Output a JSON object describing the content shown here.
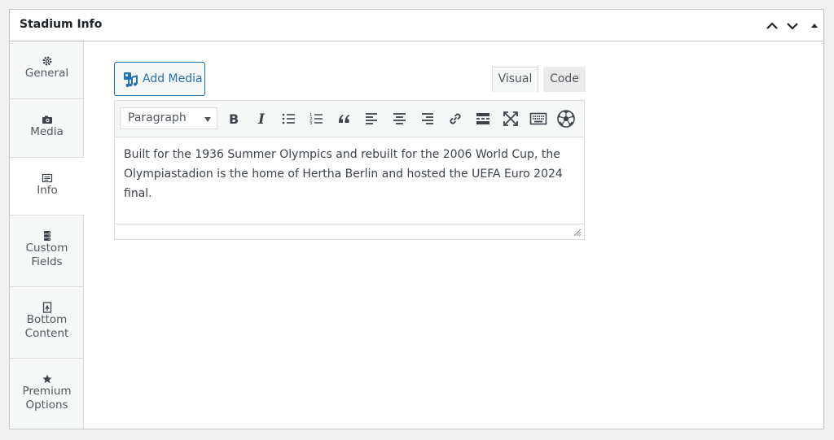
{
  "panel": {
    "title": "Stadium Info",
    "controls": [
      "chevron-up-icon",
      "chevron-down-icon",
      "triangle-up-icon"
    ]
  },
  "sidebar": {
    "items": [
      {
        "label": "General",
        "icon": "gear-icon"
      },
      {
        "label": "Media",
        "icon": "camera-icon"
      },
      {
        "label": "Info",
        "icon": "text-page-icon",
        "active": true
      },
      {
        "label": "Custom\nFields",
        "icon": "database-icon"
      },
      {
        "label": "Bottom\nContent",
        "icon": "page-icon"
      },
      {
        "label": "Premium\nOptions",
        "icon": "star-icon"
      }
    ]
  },
  "editor": {
    "add_media_label": "Add Media",
    "mode_tabs": {
      "visual": "Visual",
      "code": "Code"
    },
    "format_select": "Paragraph",
    "toolbar_icons": [
      "bold-icon",
      "italic-icon",
      "bullet-list-icon",
      "numbered-list-icon",
      "blockquote-icon",
      "align-left-icon",
      "align-center-icon",
      "align-right-icon",
      "link-icon",
      "read-more-icon",
      "fullscreen-icon",
      "keyboard-icon",
      "soccer-ball-icon"
    ],
    "content": "Built for the 1936 Summer Olympics and rebuilt for the 2006 World Cup, the Olympiastadion is the home of Hertha Berlin and hosted the UEFA Euro 2024 final."
  },
  "colors": {
    "accent": "#2271b1",
    "border": "#c3c4c7",
    "background": "#f0f0f1"
  }
}
